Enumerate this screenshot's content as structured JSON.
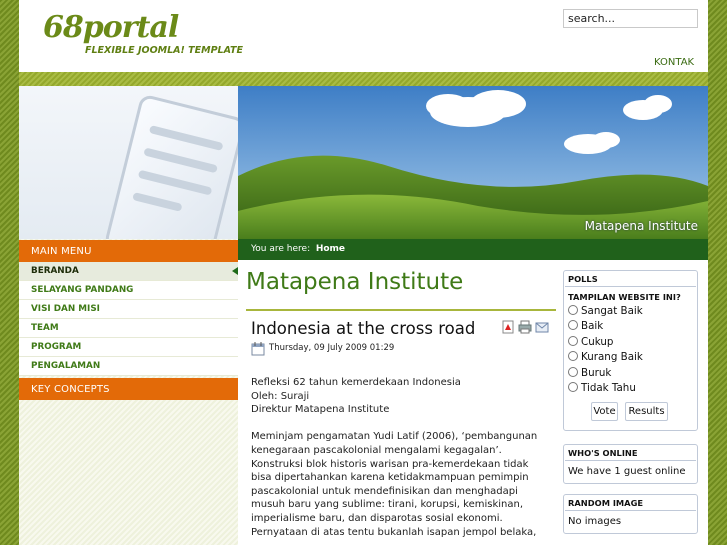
{
  "brand": {
    "logo": "68portal",
    "tagline": "FLEXIBLE JOOMLA! TEMPLATE"
  },
  "search": {
    "placeholder": "search..."
  },
  "topnav": {
    "kontak": "KONTAK"
  },
  "banner": {
    "title": "Matapena Institute"
  },
  "menu": {
    "header": "MAIN MENU",
    "items": [
      {
        "label": "BERANDA"
      },
      {
        "label": "SELAYANG PANDANG"
      },
      {
        "label": "VISI DAN MISI"
      },
      {
        "label": "TEAM"
      },
      {
        "label": "PROGRAM"
      },
      {
        "label": "PENGALAMAN"
      }
    ],
    "key_concepts": "KEY CONCEPTS"
  },
  "breadcrumb": {
    "prefix": "You are here:",
    "current": "Home"
  },
  "page": {
    "title": "Matapena Institute"
  },
  "article": {
    "title": "Indonesia at the cross road",
    "date": "Thursday, 09 July 2009 01:29",
    "lines": [
      "Refleksi 62 tahun kemerdekaan Indonesia",
      "Oleh: Suraji",
      "Direktur Matapena Institute"
    ],
    "para": [
      "Meminjam pengamatan Yudi Latif (2006), ‘pembangunan",
      "kenegaraan pascakolonial mengalami kegagalan’.",
      "Konstruksi blok historis warisan pra-kemerdekaan tidak",
      "bisa dipertahankan karena ketidakmampuan pemimpin",
      "pascakolonial untuk mendefinisikan dan menghadapi",
      "musuh baru yang sublime: tirani, korupsi, kemiskinan,",
      "imperialisme baru, dan disparotas sosial ekonomi.",
      "Pernyataan di atas tentu bukanlah isapan jempol belaka,"
    ]
  },
  "polls": {
    "title": "POLLS",
    "question": "TAMPILAN WEBSITE INI?",
    "options": [
      "Sangat Baik",
      "Baik",
      "Cukup",
      "Kurang Baik",
      "Buruk",
      "Tidak Tahu"
    ],
    "vote": "Vote",
    "results": "Results"
  },
  "whos_online": {
    "title": "WHO'S ONLINE",
    "text": "We have 1 guest online"
  },
  "random_image": {
    "title": "RANDOM IMAGE",
    "text": "No images"
  },
  "colors": {
    "menu_header": "#e36a08",
    "breadcrumb": "#20611b",
    "title_green": "#3f7a17",
    "background": "#7c9426"
  }
}
